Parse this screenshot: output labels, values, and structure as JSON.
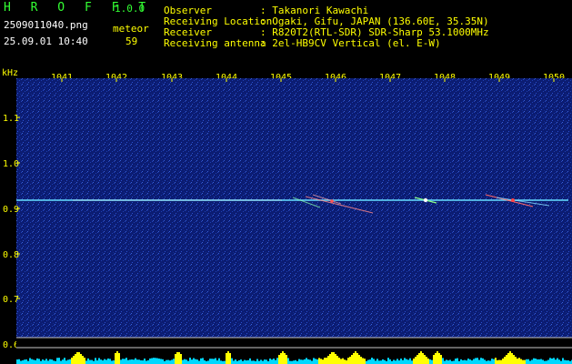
{
  "app": {
    "name": "H R O F F T",
    "version": "1.0.0"
  },
  "file": {
    "name": "2509011040.png",
    "datetime": "25.09.01 10:40"
  },
  "detection": {
    "label": "meteor",
    "count": "59"
  },
  "station": [
    {
      "key": "Observer",
      "value": ": Takanori Kawachi"
    },
    {
      "key": "Receiving Location",
      "value": ": Ogaki, Gifu, JAPAN (136.60E, 35.35N)"
    },
    {
      "key": "Receiver",
      "value": ": R820T2(RTL-SDR) SDR-Sharp 53.1000MHz"
    },
    {
      "key": "Receiving antenna",
      "value": ": 2el-HB9CV Vertical (el. E-W)"
    }
  ],
  "axis": {
    "y_unit": "kHz",
    "x_ticks": [
      "1041",
      "1042",
      "1043",
      "1044",
      "1045",
      "1046",
      "1047",
      "1048",
      "1049",
      "1050"
    ],
    "y_ticks": [
      "1.1",
      "1.0",
      "0.9",
      "0.8",
      "0.7",
      "0.6"
    ]
  },
  "colors": {
    "background": "#000000",
    "header_green": "#33ff33",
    "header_yellow": "#ffff00",
    "spectrogram_bg": "#0a1a6e",
    "carrier_line": "#66ddff",
    "activity_bar": "#00d8ff",
    "activity_peak": "#ffff00"
  }
}
